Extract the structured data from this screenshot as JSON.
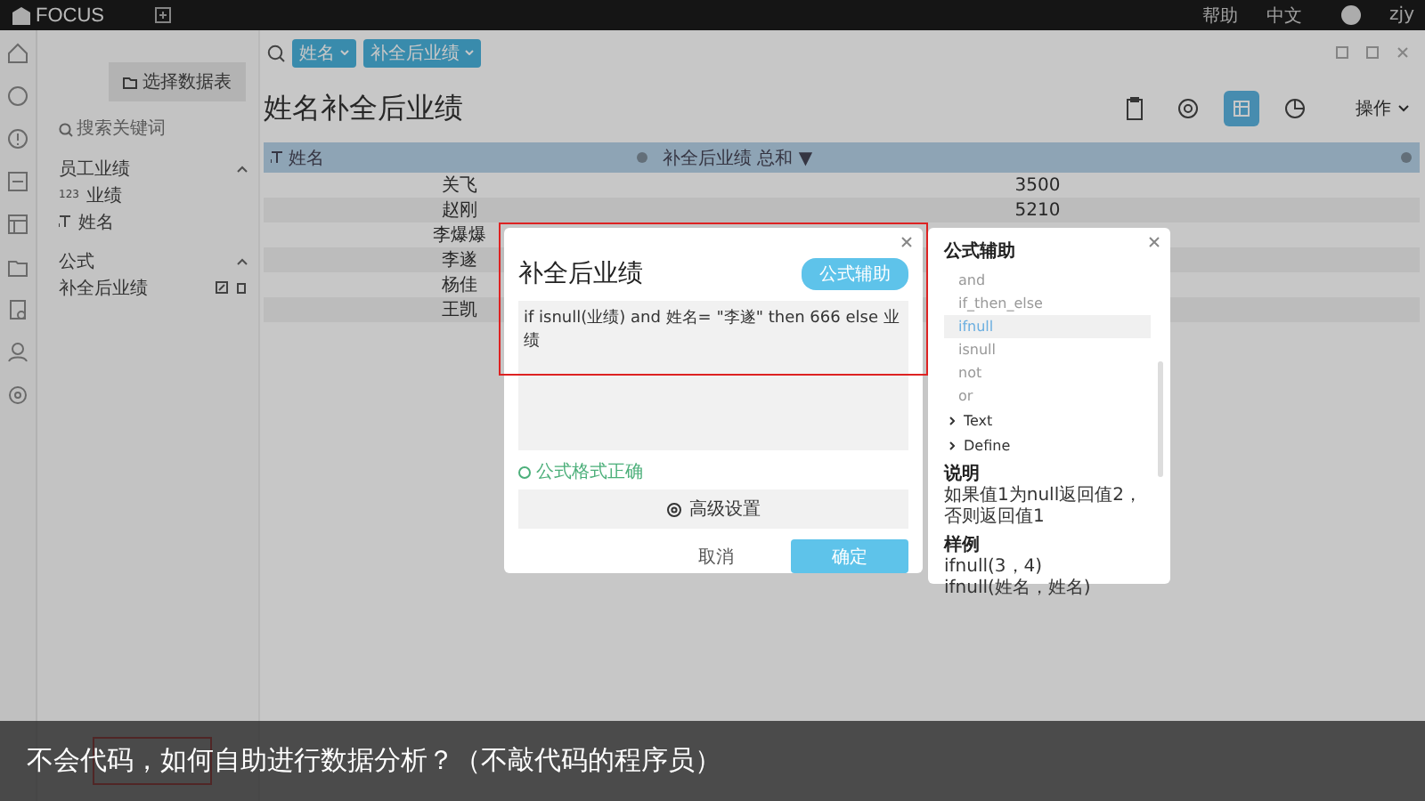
{
  "top_bar": {
    "logo": "FOCUS",
    "links": [
      "帮助",
      "中文"
    ],
    "user": "zjy"
  },
  "sidebar": {
    "select_button": "选择数据表",
    "search": {
      "placeholder": "搜索关键词"
    },
    "groups": [
      {
        "title": "员工业绩",
        "expanded": true,
        "items": [
          {
            "kind": "number",
            "type_label": "123",
            "label": "业绩"
          },
          {
            "kind": "text",
            "label": "姓名"
          }
        ]
      },
      {
        "title": "公式",
        "expanded": true,
        "items": [
          {
            "kind": "formula",
            "label": "补全后业绩"
          }
        ]
      }
    ]
  },
  "toolbar": {
    "chips": [
      "姓名",
      "补全后业绩"
    ]
  },
  "title": "姓名补全后业绩",
  "views": [
    {
      "kind": "clipboard",
      "selected": false
    },
    {
      "kind": "settings",
      "selected": false
    },
    {
      "kind": "table",
      "selected": true
    },
    {
      "kind": "pie",
      "selected": false
    }
  ],
  "actions": "操作",
  "table": {
    "columns": [
      "姓名",
      "补全后业绩 总和 ▼"
    ],
    "rows": [
      [
        "关飞",
        "3500"
      ],
      [
        "赵刚",
        "5210"
      ],
      [
        "李爆爆",
        ""
      ],
      [
        "李遂",
        ""
      ],
      [
        "杨佳",
        ""
      ],
      [
        "王凯",
        ""
      ]
    ]
  },
  "dialog": {
    "title": "补全后业绩",
    "helper_button": "公式辅助",
    "formula": "if isnull(业绩) and 姓名= \"李遂\" then 666 else 业绩",
    "status": "公式格式正确",
    "advanced": "高级设置",
    "cancel": "取消",
    "confirm": "确定"
  },
  "helper": {
    "title": "公式辅助",
    "items": [
      {
        "kind": "function",
        "label": "and",
        "selected": false
      },
      {
        "kind": "function",
        "label": "if_then_else",
        "selected": false
      },
      {
        "kind": "function",
        "label": "ifnull",
        "selected": true
      },
      {
        "kind": "function",
        "label": "isnull",
        "selected": false
      },
      {
        "kind": "function",
        "label": "not",
        "selected": false
      },
      {
        "kind": "function",
        "label": "or",
        "selected": false
      },
      {
        "kind": "category",
        "label": "Text",
        "selected": false
      },
      {
        "kind": "category",
        "label": "Define",
        "selected": false
      }
    ],
    "note_title": "说明",
    "note": "如果值1为null返回值2，否则返回值1",
    "example_title": "样例",
    "examples": [
      "ifnull(3，4)",
      "ifnull(姓名，姓名)"
    ]
  },
  "caption": "不会代码，如何自助进行数据分析？（不敲代码的程序员）"
}
